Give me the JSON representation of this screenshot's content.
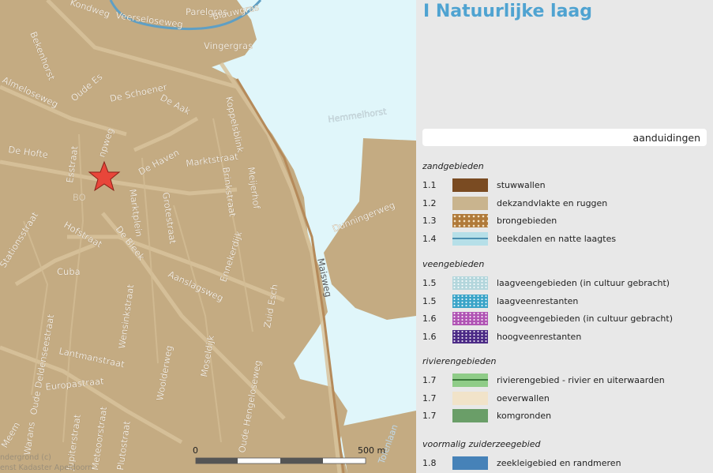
{
  "legend": {
    "title": "I Natuurlijke laag",
    "search_label": "aanduidingen",
    "groups": [
      {
        "title": "zandgebieden",
        "items": [
          {
            "code": "1.1",
            "label": "stuwwallen",
            "color": "#7a4b22",
            "pattern": "solid"
          },
          {
            "code": "1.2",
            "label": "dekzandvlakte en ruggen",
            "color": "#c9b48e",
            "pattern": "solid"
          },
          {
            "code": "1.3",
            "label": "brongebieden",
            "color": "#b07a3a",
            "pattern": "dots"
          },
          {
            "code": "1.4",
            "label": "beekdalen en natte laagtes",
            "color": "#b6dfe8",
            "pattern": "line"
          }
        ]
      },
      {
        "title": "veengebieden",
        "items": [
          {
            "code": "1.5",
            "label": "laagveengebieden (in cultuur gebracht)",
            "color": "#b3d6dc",
            "pattern": "speckle"
          },
          {
            "code": "1.5",
            "label": "laagveenrestanten",
            "color": "#3aa4c8",
            "pattern": "speckle"
          },
          {
            "code": "1.6",
            "label": "hoogveengebieden (in cultuur gebracht)",
            "color": "#b054b4",
            "pattern": "speckle"
          },
          {
            "code": "1.6",
            "label": "hoogveenrestanten",
            "color": "#4b2a86",
            "pattern": "speckle"
          }
        ]
      },
      {
        "title": "rivierengebieden",
        "items": [
          {
            "code": "1.7",
            "label": "rivierengebied - rivier en uiterwaarden",
            "color": "#8fcc88",
            "pattern": "line-dark"
          },
          {
            "code": "1.7",
            "label": "oeverwallen",
            "color": "#f1e3c9",
            "pattern": "solid"
          },
          {
            "code": "1.7",
            "label": "komgronden",
            "color": "#6a9e68",
            "pattern": "solid"
          }
        ]
      },
      {
        "title": "voormalig zuiderzeegebied",
        "items": [
          {
            "code": "1.8",
            "label": "zeekleigebied en randmeren",
            "color": "#4682b8",
            "pattern": "solid"
          }
        ]
      }
    ]
  },
  "map": {
    "colors": {
      "sand": "#c4ab82",
      "brook_valley": "#e0f6fa",
      "marker": "#e8463a"
    },
    "streets": [
      {
        "id": "kondweg",
        "text": "Kondweg"
      },
      {
        "id": "veerseloseweg",
        "text": "Veerseloseweg"
      },
      {
        "id": "parelgras",
        "text": "Parelgras"
      },
      {
        "id": "blauwgras",
        "text": "Blauwgras"
      },
      {
        "id": "vingergras",
        "text": "Vingergras"
      },
      {
        "id": "bekenhorst",
        "text": "Bekenhorst"
      },
      {
        "id": "almeloseweg",
        "text": "Almeloseweg"
      },
      {
        "id": "oude-es",
        "text": "Oude Es"
      },
      {
        "id": "de-schoener",
        "text": "De Schoener"
      },
      {
        "id": "de-aak",
        "text": "De Aak"
      },
      {
        "id": "koppelsblink",
        "text": "Koppelsblink"
      },
      {
        "id": "hemmelhorst",
        "text": "Hemmelhorst"
      },
      {
        "id": "de-hofte",
        "text": "De Hofte"
      },
      {
        "id": "esstraat",
        "text": "Esstraat"
      },
      {
        "id": "kerkweg",
        "text": "npweg"
      },
      {
        "id": "de-haven",
        "text": "De Haven"
      },
      {
        "id": "marktstraat",
        "text": "Marktstraat"
      },
      {
        "id": "brinkstraat",
        "text": "Brinkstraat"
      },
      {
        "id": "meijerhof",
        "text": "Meijerhof"
      },
      {
        "id": "bornerbroek",
        "text": "BO"
      },
      {
        "id": "marktplein",
        "text": "Marktplein"
      },
      {
        "id": "grotestraat",
        "text": "Grotestraat"
      },
      {
        "id": "hofstraat",
        "text": "Hofstraat"
      },
      {
        "id": "de-bleek",
        "text": "De Bleek"
      },
      {
        "id": "enneker",
        "text": "Ennekerdijk"
      },
      {
        "id": "dunningerweg",
        "text": "Dunningerweg"
      },
      {
        "id": "stationsstraat",
        "text": "Stationsstraat"
      },
      {
        "id": "cuba",
        "text": "Cuba"
      },
      {
        "id": "aanslagsweg",
        "text": "Aanslagsweg"
      },
      {
        "id": "maisweg",
        "text": "Maisweg"
      },
      {
        "id": "oosterstraat",
        "text": "Oude Deldenseestraat"
      },
      {
        "id": "wensinkstraat",
        "text": "Wensinkstraat"
      },
      {
        "id": "zuid-esch",
        "text": "Zuid Esch"
      },
      {
        "id": "lantmanstraat",
        "text": "Lantmanstraat"
      },
      {
        "id": "oude-deldens",
        "text": "Oude Deldenseestraat"
      },
      {
        "id": "europastraat",
        "text": "Europastraat"
      },
      {
        "id": "woolderweg",
        "text": "Woolderweg"
      },
      {
        "id": "moseldijk",
        "text": "Moseldijk"
      },
      {
        "id": "oude-hengeloseweg",
        "text": "Oude Hengeloseweg"
      },
      {
        "id": "warans",
        "text": "Warans"
      },
      {
        "id": "jupiterstraat",
        "text": "Jupiterstraat"
      },
      {
        "id": "meteoorstraat",
        "text": "Meteoorstraat"
      },
      {
        "id": "plutostraat",
        "text": "Plutostraat"
      },
      {
        "id": "tolenlaan",
        "text": "Tolenlaan"
      },
      {
        "id": "meem",
        "text": "Meem"
      }
    ],
    "scale": {
      "start_label": "0",
      "end_label": "500 m"
    },
    "attribution": [
      "ndergrond (c)",
      "enst Kadaster Apeldoorn"
    ]
  }
}
